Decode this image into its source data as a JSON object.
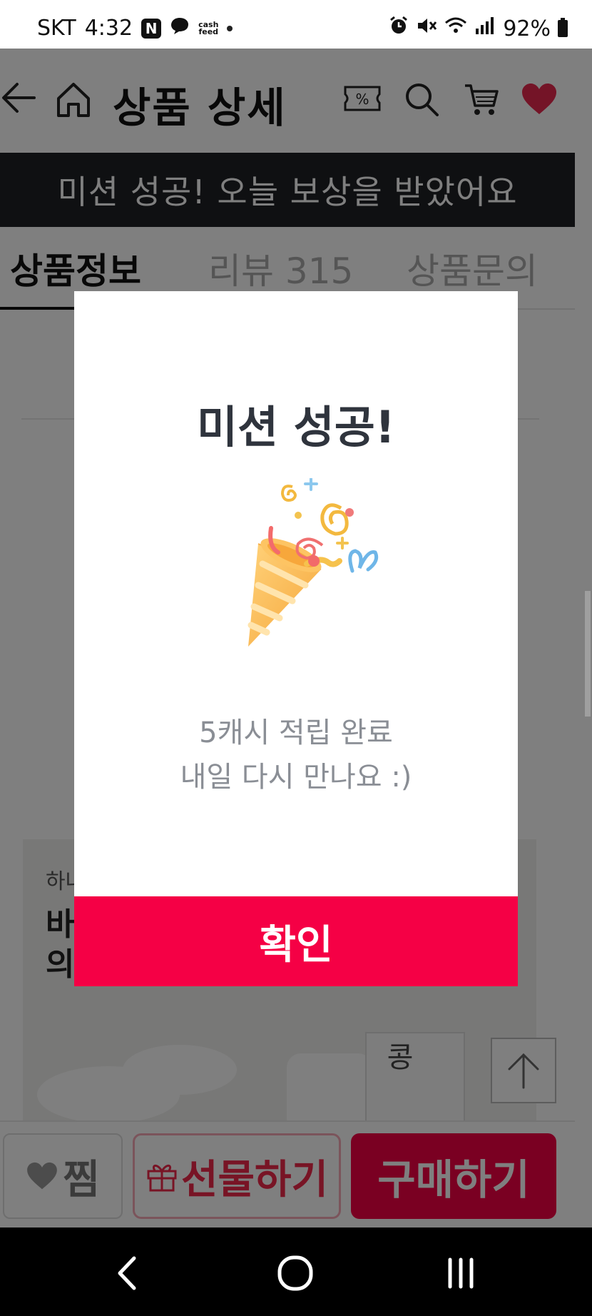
{
  "status_bar": {
    "carrier": "SKT",
    "time": "4:32",
    "notification_badge": "N",
    "cash_feed_line1": "cash",
    "cash_feed_line2": "feed",
    "battery": "92%"
  },
  "header": {
    "title": "상품 상세",
    "coupon_symbol": "%",
    "heart_color": "#e8284e"
  },
  "mission_banner": "미션 성공! 오늘 보상을 받았어요",
  "tabs": [
    {
      "label": "상품정보",
      "active": true
    },
    {
      "label": "리뷰 315",
      "active": false
    },
    {
      "label": "상품문의",
      "active": false
    }
  ],
  "promo": {
    "small_text": "하나",
    "headline_line1": "바",
    "headline_line2": "의",
    "carton_text": "콩"
  },
  "bottom_bar": {
    "zzim_label": "찜",
    "gift_label": "선물하기",
    "buy_label": "구매하기"
  },
  "modal": {
    "title": "미션 성공!",
    "message_line1": "5캐시 적립 완료",
    "message_line2": "내일 다시 만나요 :)",
    "confirm_label": "확인",
    "accent_color": "#f50045"
  },
  "icons": {
    "back": "arrow-left-icon",
    "home": "home-icon",
    "coupon": "coupon-icon",
    "search": "search-icon",
    "cart": "cart-icon",
    "heart": "heart-icon",
    "party": "party-popper-icon"
  }
}
